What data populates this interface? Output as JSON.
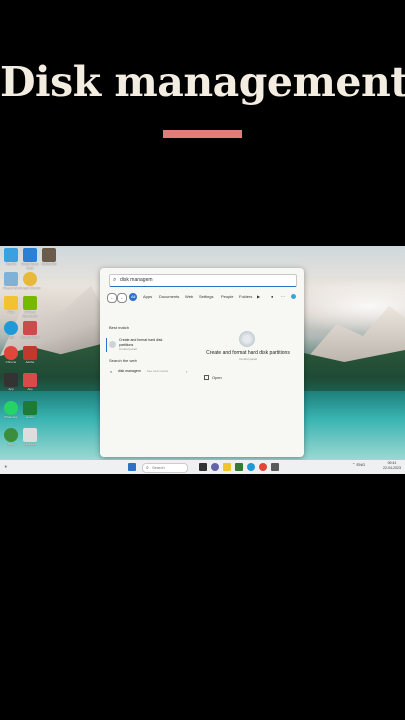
{
  "overlay": {
    "title": "Disk management",
    "accent_color": "#e07d78"
  },
  "desktop": {
    "icons": [
      {
        "label": "This PC",
        "color": "#3aa0e0"
      },
      {
        "label": "Visual Studio Code",
        "color": "#2b7fd4"
      },
      {
        "label": "WINWORD",
        "color": "#6b5b4b"
      },
      {
        "label": "Recycle Bin",
        "color": "#7fb2d6"
      },
      {
        "label": "Google Chrome",
        "color": "#e8b83a"
      },
      {
        "label": "Files",
        "color": "#f1c232"
      },
      {
        "label": "GeForce Experience",
        "color": "#76b900"
      },
      {
        "label": "Edge",
        "color": "#1f9ad6"
      },
      {
        "label": "Control Panel",
        "color": "#cc4b4b"
      },
      {
        "label": "Chrome",
        "color": "#e0463a"
      },
      {
        "label": "Adobe",
        "color": "#c0392b"
      },
      {
        "label": "App",
        "color": "#333333"
      },
      {
        "label": "App",
        "color": "#d94b4b"
      },
      {
        "label": "WhatsApp",
        "color": "#25d366"
      },
      {
        "label": "Excel",
        "color": "#1f7a3a"
      },
      {
        "label": "Xbox",
        "color": "#3b8e3b"
      },
      {
        "label": "Notepad",
        "color": "#dddddd"
      }
    ]
  },
  "search": {
    "query": "disk managem",
    "filters": [
      "All",
      "Apps",
      "Documents",
      "Web",
      "Settings",
      "People",
      "Folders"
    ],
    "best_match_heading": "Best match",
    "best_match": {
      "line1": "Create and format hard disk",
      "line2": "partitions",
      "line3": "Control panel"
    },
    "web_heading": "Search the web",
    "web_item": {
      "query": "disk managem",
      "hint": "- See web results"
    },
    "detail": {
      "title": "Create and format hard disk partitions",
      "subtitle": "Control panel",
      "open_label": "Open"
    }
  },
  "taskbar": {
    "weather": "☀",
    "search_placeholder": "Search",
    "clock_time": "09:41",
    "clock_date": "22-04-2023",
    "tray_label": "ENG"
  }
}
